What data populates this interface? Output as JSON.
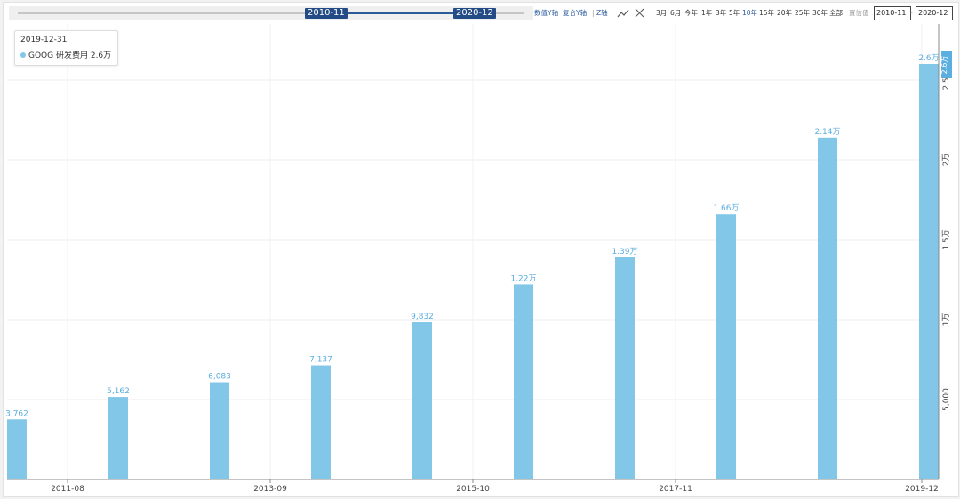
{
  "toolbar": {
    "range_start": "2010-11",
    "range_end": "2020-12",
    "btn_value_axis": "数值Y轴",
    "btn_compound_axis": "复合Y轴",
    "btn_z_axis": "Z轴",
    "ranges": [
      "3月",
      "6月",
      "今年",
      "1年",
      "3年",
      "5年",
      "10年",
      "15年",
      "20年",
      "25年",
      "30年",
      "全部"
    ],
    "active_range": "10年",
    "confidence_label": "置信值",
    "date_from": "2010-11",
    "date_to": "2020-12",
    "icons": {
      "line": "line-chart-icon",
      "close": "close-icon"
    }
  },
  "tooltip": {
    "date": "2019-12-31",
    "series_text": "GOOG 研发费用 2.6万"
  },
  "colors": {
    "bar": "#82c7e8",
    "label": "#5aaee0",
    "current_tag": "#5aaee0",
    "active_range": "#2b5a9b"
  },
  "chart_data": {
    "type": "bar",
    "series": [
      {
        "name": "GOOG 研发费用",
        "values": [
          3762,
          5162,
          6083,
          7137,
          9832,
          12200,
          13900,
          16600,
          21400,
          26000
        ],
        "labels": [
          "3,762",
          "5,162",
          "6,083",
          "7,137",
          "9,832",
          "1.22万",
          "1.39万",
          "1.66万",
          "2.14万",
          "2.6万"
        ]
      }
    ],
    "x_ticks": [
      "2011-08",
      "2013-09",
      "2015-10",
      "2017-11",
      "2019-12"
    ],
    "y_ticks": [
      5000,
      10000,
      15000,
      20000,
      25000
    ],
    "y_tick_labels": [
      "5,000",
      "1万",
      "1.5万",
      "2万",
      "2.5万"
    ],
    "ylim": [
      0,
      29000
    ],
    "current_value_label": "2.6万",
    "grid": true,
    "y_axis_position": "right",
    "title": "",
    "xlabel": "",
    "ylabel": ""
  }
}
